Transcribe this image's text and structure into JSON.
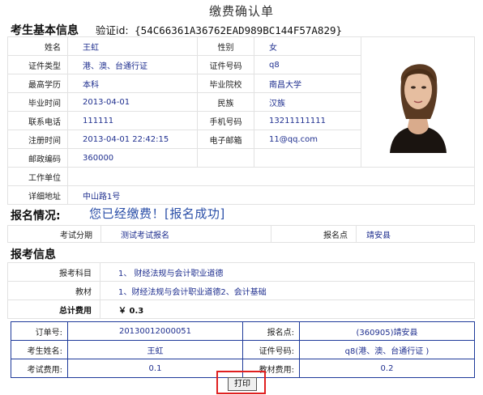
{
  "page_title": "缴费确认单",
  "basic": {
    "heading": "考生基本信息",
    "verify_label": "验证id:",
    "verify_id": "{54C66361A36762EAD989BC144F57A829}",
    "name_label": "姓名",
    "name": "王虹",
    "gender_label": "性别",
    "gender": "女",
    "id_type_label": "证件类型",
    "id_type": "港、澳、台通行证",
    "id_no_label": "证件号码",
    "id_no": "q8",
    "education_label": "最高学历",
    "education": "本科",
    "school_label": "毕业院校",
    "school": "南昌大学",
    "grad_time_label": "毕业时间",
    "grad_time": "2013-04-01",
    "ethnic_label": "民族",
    "ethnic": "汉族",
    "phone_label": "联系电话",
    "phone": "111111",
    "mobile_label": "手机号码",
    "mobile": "13211111111",
    "reg_time_label": "注册时间",
    "reg_time": "2013-04-01 22:42:15",
    "email_label": "电子邮箱",
    "email": "11@qq.com",
    "postcode_label": "邮政编码",
    "postcode": "360000",
    "workplace_label": "工作单位",
    "workplace": "",
    "address_label": "详细地址",
    "address": "中山路1号"
  },
  "registration": {
    "heading": "报名情况:",
    "status": "您已经缴费！[报名成功]",
    "session_label": "考试分期",
    "session": "测试考试报名",
    "site_label": "报名点",
    "site": "靖安县"
  },
  "exam": {
    "heading": "报考信息",
    "subject_label": "报考科目",
    "subject": "1、 财经法规与会计职业道德",
    "textbook_label": "教材",
    "textbook": "1、财经法规与会计职业道德2、会计基础",
    "total_label": "总计费用",
    "total": "￥ 0.3"
  },
  "order": {
    "order_no_label": "订单号:",
    "order_no": "20130012000051",
    "site_label": "报名点:",
    "site": "(360905)靖安县",
    "name_label": "考生姓名:",
    "name": "王虹",
    "id_label": "证件号码:",
    "id": "q8(港、澳、台通行证 )",
    "exam_fee_label": "考试费用:",
    "exam_fee": "0.1",
    "book_fee_label": "教材费用:",
    "book_fee": "0.2"
  },
  "print_label": "打印",
  "colors": {
    "value_blue": "#1f2f8f",
    "status_blue": "#2b4fa8",
    "order_border": "#1e3a9a",
    "highlight_red": "#e02020"
  }
}
